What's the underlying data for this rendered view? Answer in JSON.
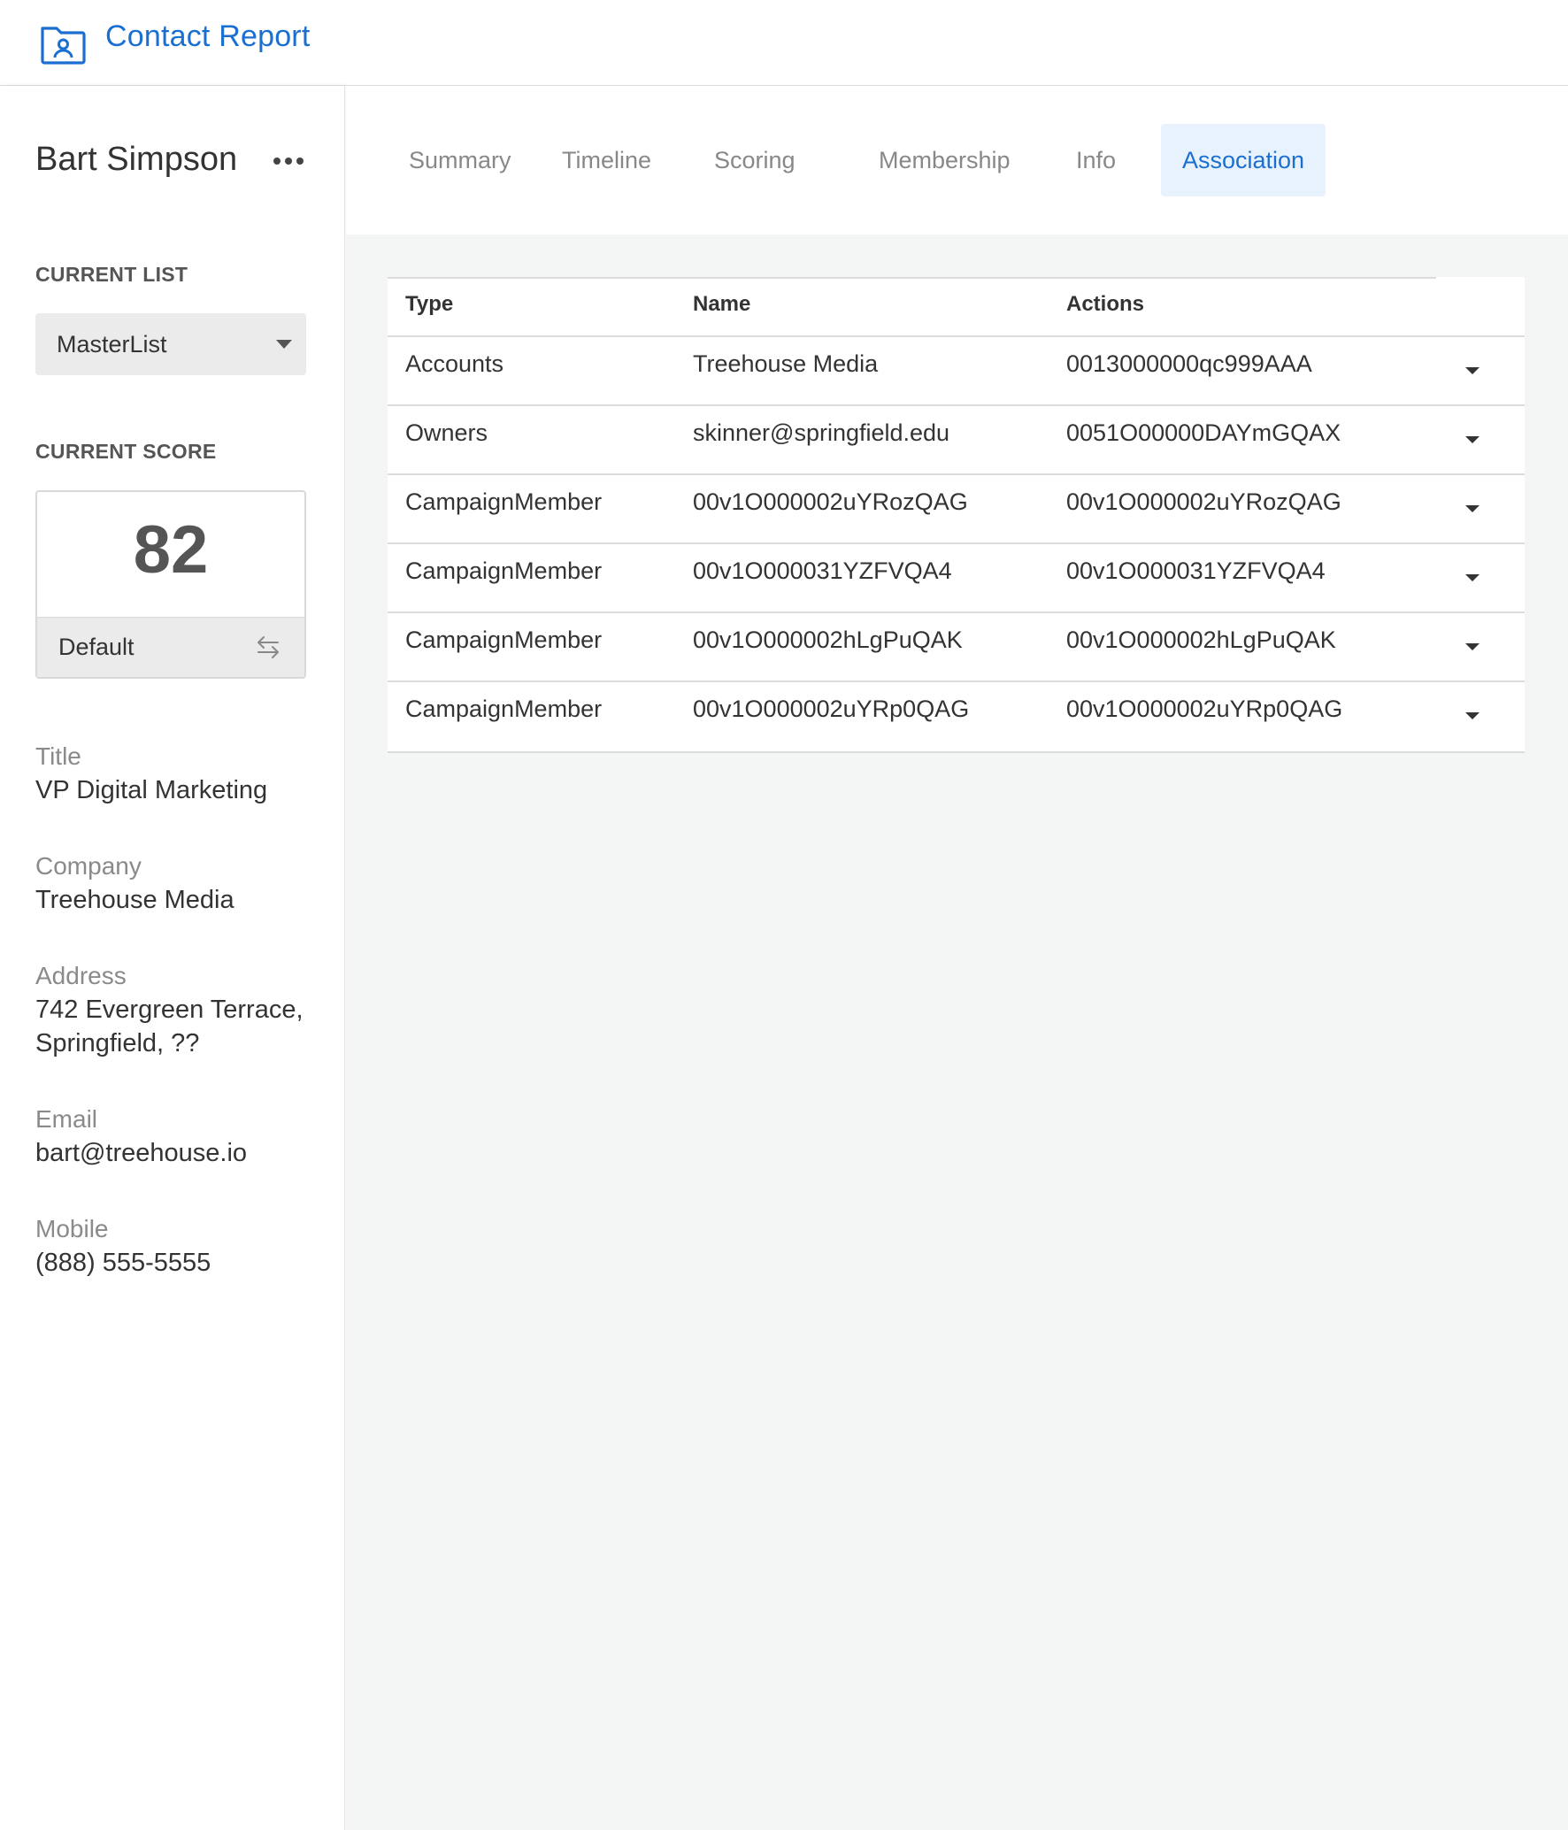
{
  "app": {
    "title": "Contact Report",
    "accent_color": "#1a6fd1",
    "logo_icon": "folder-user-icon"
  },
  "contact": {
    "name": "Bart Simpson",
    "menu_icon": "more-horizontal-icon"
  },
  "current_list": {
    "label": "CURRENT LIST",
    "selected": "MasterList"
  },
  "current_score": {
    "label": "CURRENT SCORE",
    "value": "82",
    "model": "Default",
    "switch_icon": "swap-arrows-icon"
  },
  "fields": [
    {
      "label": "Title",
      "value": "VP Digital Marketing"
    },
    {
      "label": "Company",
      "value": "Treehouse Media"
    },
    {
      "label": "Address",
      "value_line1": "742 Evergreen Terrace,",
      "value_line2": "Springfield, ??"
    },
    {
      "label": "Email",
      "value": "bart@treehouse.io"
    },
    {
      "label": "Mobile",
      "value": "(888) 555-5555"
    }
  ],
  "tabs": [
    {
      "label": "Summary",
      "active": false
    },
    {
      "label": "Timeline",
      "active": false
    },
    {
      "label": "Scoring",
      "active": false
    },
    {
      "label": "Membership",
      "active": false
    },
    {
      "label": "Info",
      "active": false
    },
    {
      "label": "Association",
      "active": true
    }
  ],
  "association_table": {
    "columns": [
      "Type",
      "Name",
      "Actions"
    ],
    "rows": [
      {
        "type": "Accounts",
        "name": "Treehouse Media",
        "action": "0013000000qc999AAA"
      },
      {
        "type": "Owners",
        "name": "skinner@springfield.edu",
        "action": "0051O00000DAYmGQAX"
      },
      {
        "type": "CampaignMember",
        "name": "00v1O000002uYRozQAG",
        "action": "00v1O000002uYRozQAG"
      },
      {
        "type": "CampaignMember",
        "name": "00v1O000031YZFVQA4",
        "action": "00v1O000031YZFVQA4"
      },
      {
        "type": "CampaignMember",
        "name": "00v1O000002hLgPuQAK",
        "action": "00v1O000002hLgPuQAK"
      },
      {
        "type": "CampaignMember",
        "name": "00v1O000002uYRp0QAG",
        "action": "00v1O000002uYRp0QAG"
      }
    ]
  }
}
